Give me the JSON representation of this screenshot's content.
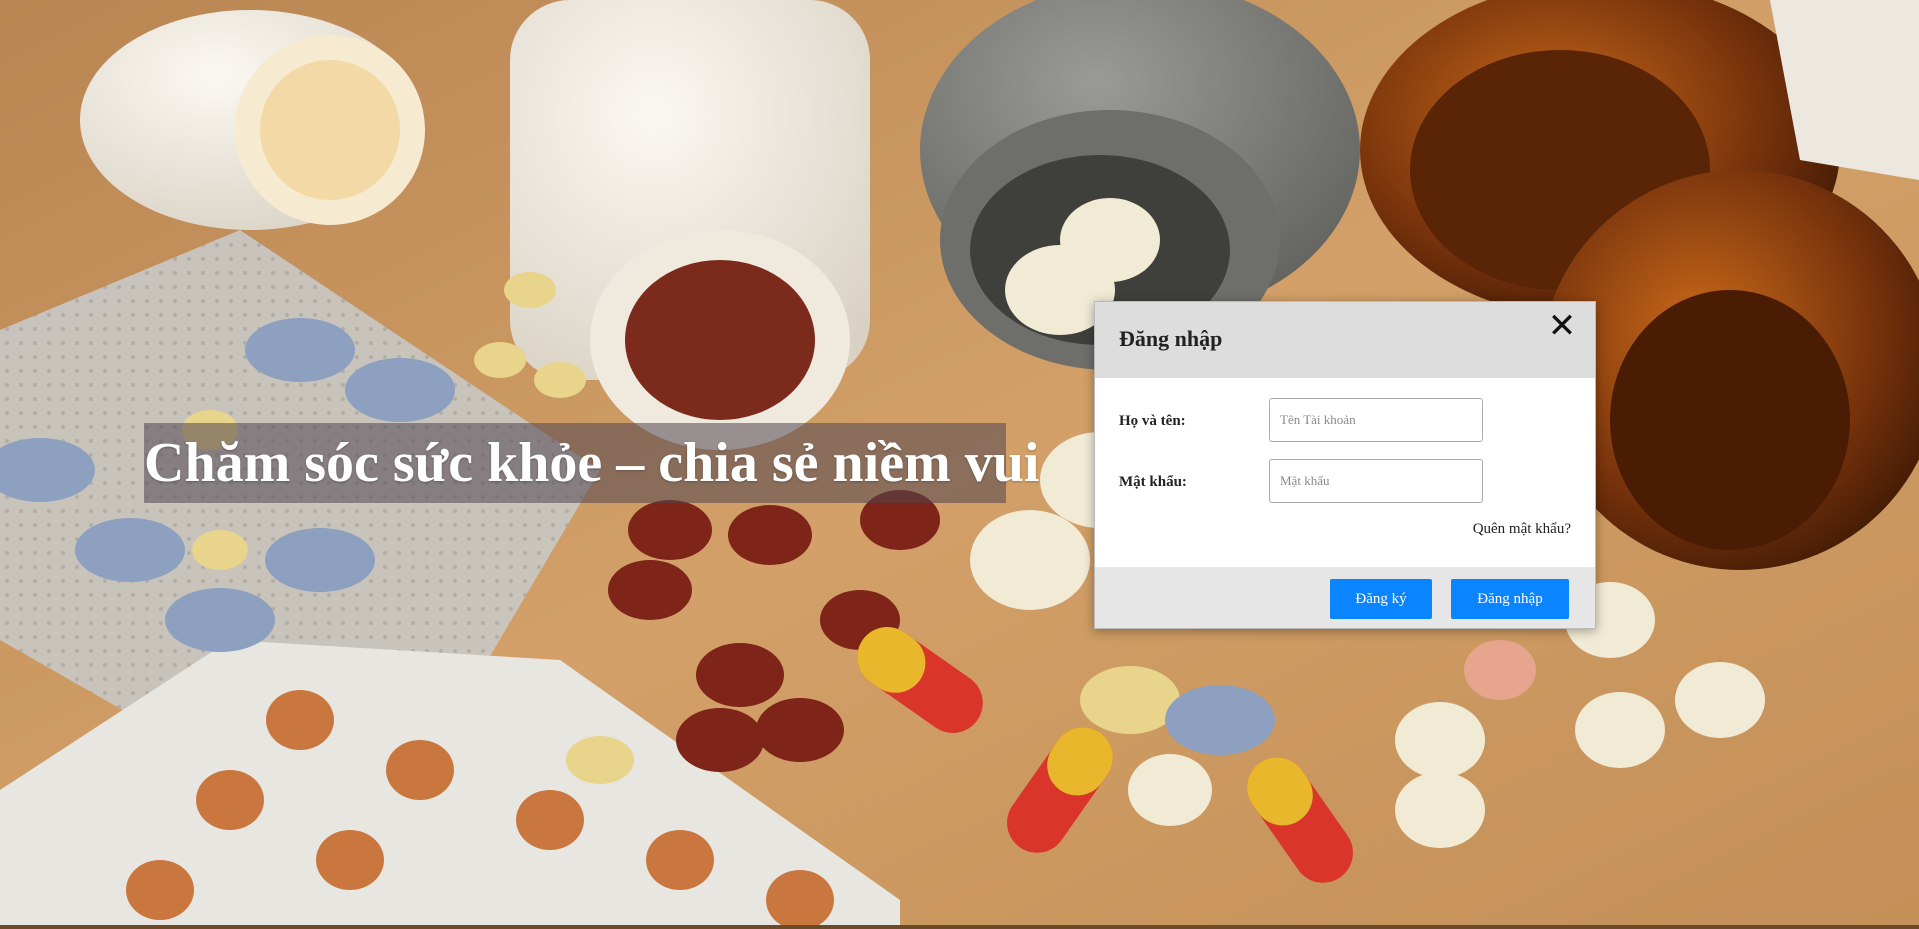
{
  "hero": {
    "text": "Chăm sóc sức khỏe – chia sẻ niềm vui"
  },
  "login_modal": {
    "title": "Đăng nhập",
    "close_icon": "close-icon",
    "username_label": "Họ và tên:",
    "username_placeholder": "Tên Tài khoản",
    "username_value": "",
    "password_label": "Mật khẩu:",
    "password_placeholder": "Mật khẩu",
    "password_value": "",
    "forgot_link": "Quên mật khẩu?",
    "register_button": "Đăng ký",
    "login_button": "Đăng nhập"
  },
  "colors": {
    "primary_button": "#0a84ff",
    "modal_header": "#dddddd",
    "modal_footer": "#e6e6e6",
    "background_wood": "#c9965e"
  }
}
